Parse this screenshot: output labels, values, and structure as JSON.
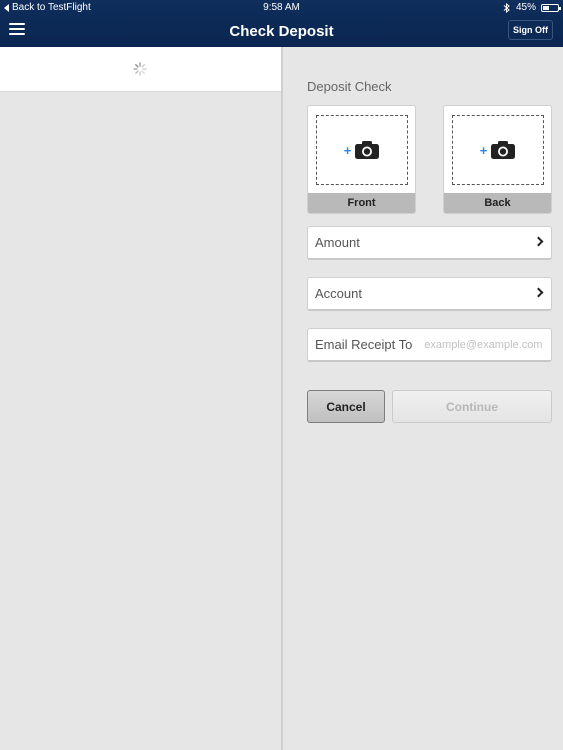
{
  "status_bar": {
    "back_label": "Back to TestFlight",
    "time": "9:58 AM",
    "battery_text": "45%",
    "battery_level": 0.45
  },
  "nav": {
    "title": "Check Deposit",
    "sign_off_label": "Sign Off"
  },
  "deposit": {
    "section_label": "Deposit Check",
    "front_label": "Front",
    "back_label": "Back",
    "amount_label": "Amount",
    "account_label": "Account",
    "email_label": "Email Receipt To",
    "email_placeholder": "example@example.com",
    "email_value": "",
    "cancel_label": "Cancel",
    "continue_label": "Continue"
  },
  "colors": {
    "header_bg": "#0f2e5c",
    "accent_plus": "#2f86d8",
    "pane_bg": "#e6e6e6"
  },
  "icons": [
    "back-arrow-icon",
    "bluetooth-icon",
    "battery-icon",
    "menu-icon",
    "loading-spinner-icon",
    "camera-icon",
    "chevron-right-icon",
    "drag-handle-icon"
  ]
}
